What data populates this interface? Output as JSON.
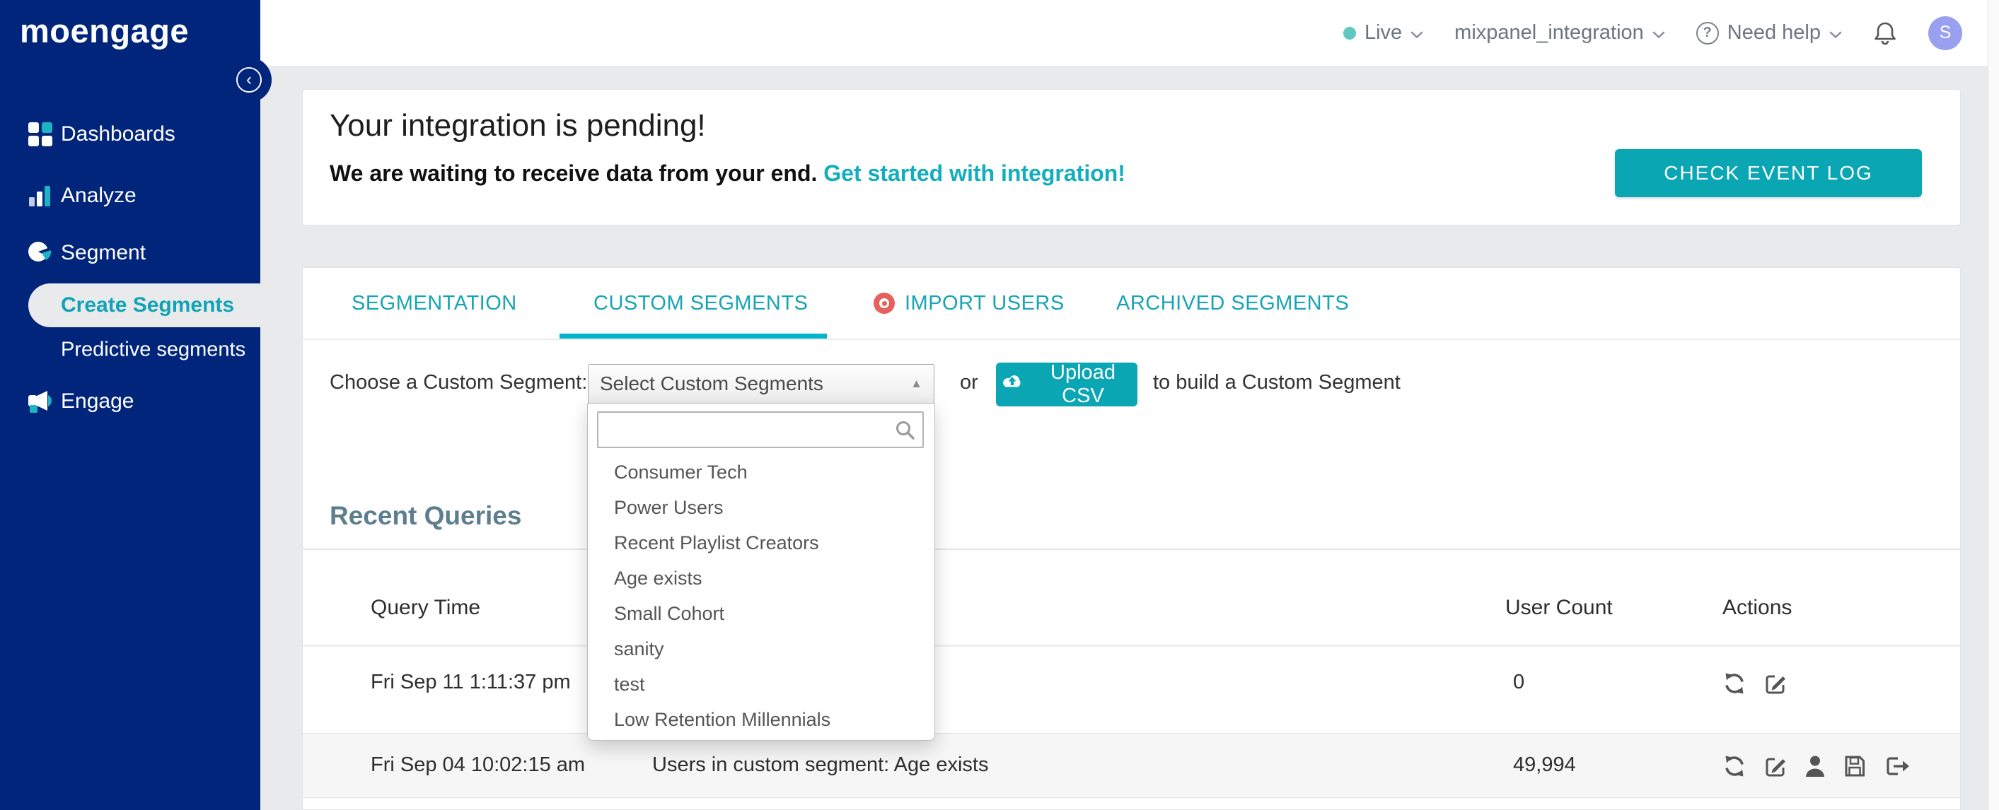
{
  "colors": {
    "sidebar_navy": "#00257b",
    "accent_teal": "#0aa6b4",
    "tab_teal": "#17a4b4",
    "underline_teal": "#00b4c9",
    "link_teal": "#11aebe",
    "content_bg": "#e9eaec",
    "heading_slate": "#5d7e8e",
    "import_dot_red": "#e4615d",
    "avatar_purple": "#98a0ef",
    "live_dot_teal": "#5fc8c1"
  },
  "brand": {
    "logo_text": "moengage"
  },
  "sidebar": {
    "items": [
      {
        "label": "Dashboards"
      },
      {
        "label": "Analyze"
      },
      {
        "label": "Segment"
      },
      {
        "label": "Create Segments",
        "active": true
      },
      {
        "label": "Predictive segments"
      },
      {
        "label": "Engage"
      }
    ]
  },
  "topbar": {
    "environment_label": "Live",
    "project_name": "mixpanel_integration",
    "help_label": "Need help",
    "help_glyph": "?",
    "avatar_initial": "S"
  },
  "banner": {
    "title": "Your integration is pending!",
    "subtitle": "We are waiting to receive data from your end.",
    "link_label": "Get started with integration!",
    "button_label": "CHECK EVENT LOG"
  },
  "tabs": {
    "items": [
      {
        "label": "SEGMENTATION",
        "active": false
      },
      {
        "label": "CUSTOM SEGMENTS",
        "active": true
      },
      {
        "label": "IMPORT USERS",
        "active": false
      },
      {
        "label": "ARCHIVED SEGMENTS",
        "active": false
      }
    ]
  },
  "segment_picker": {
    "choose_label": "Choose a Custom Segment:",
    "select_value": "Select Custom Segments",
    "or_label": "or",
    "upload_button_label": "Upload CSV",
    "build_label": "to build a Custom Segment",
    "search_value": "",
    "options": [
      "Consumer Tech",
      "Power Users",
      "Recent Playlist Creators",
      "Age exists",
      "Small Cohort",
      "sanity",
      "test",
      "Low Retention Millennials"
    ]
  },
  "recent_queries": {
    "heading": "Recent Queries",
    "columns": [
      "Query Time",
      "User Count",
      "Actions"
    ],
    "rows": [
      {
        "query_time": "Fri Sep 11 1:11:37 pm",
        "query": "",
        "user_count": "0",
        "actions": [
          "refresh",
          "edit"
        ]
      },
      {
        "query_time": "Fri Sep 04 10:02:15 am",
        "query": "Users in custom segment: Age exists",
        "user_count": "49,994",
        "actions": [
          "refresh",
          "edit",
          "user",
          "save",
          "export"
        ]
      }
    ]
  }
}
